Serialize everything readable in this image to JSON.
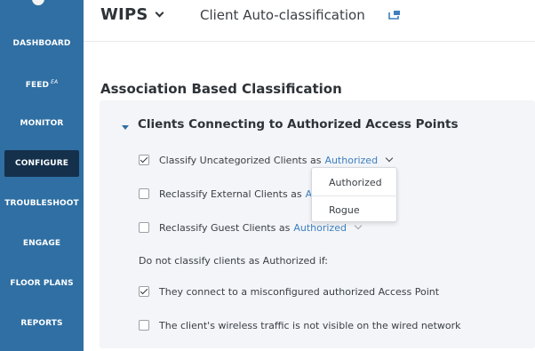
{
  "sidebar": {
    "items": [
      {
        "label": "DASHBOARD"
      },
      {
        "label": "FEED",
        "badge": "EA"
      },
      {
        "label": "MONITOR"
      },
      {
        "label": "CONFIGURE",
        "active": true
      },
      {
        "label": "TROUBLESHOOT"
      },
      {
        "label": "ENGAGE"
      },
      {
        "label": "FLOOR PLANS"
      },
      {
        "label": "REPORTS"
      }
    ]
  },
  "header": {
    "app_title": "WIPS",
    "page_title": "Client Auto-classification",
    "link_icon": "external-link-icon"
  },
  "main": {
    "section_title": "Association Based Classification",
    "subsection_title": "Clients Connecting to Authorized Access Points",
    "options": [
      {
        "label": "Classify Uncategorized Clients as",
        "value": "Authorized",
        "checked": true
      },
      {
        "label": "Reclassify External Clients as",
        "value": "Auth",
        "checked": false
      },
      {
        "label": "Reclassify Guest Clients as",
        "value": "Authorized",
        "checked": false
      }
    ],
    "exceptions_intro": "Do not classify clients as Authorized if:",
    "exceptions": [
      {
        "label": "They connect to a misconfigured authorized Access Point",
        "checked": true
      },
      {
        "label": "The client's wireless traffic is not visible on the wired network",
        "checked": false
      }
    ]
  },
  "dropdown": {
    "options": [
      "Authorized",
      "Rogue"
    ]
  },
  "colors": {
    "sidebar_bg": "#2f6fa3",
    "sidebar_active": "#14304b",
    "link": "#3d7fc0",
    "card_bg": "#f3f5f8"
  }
}
